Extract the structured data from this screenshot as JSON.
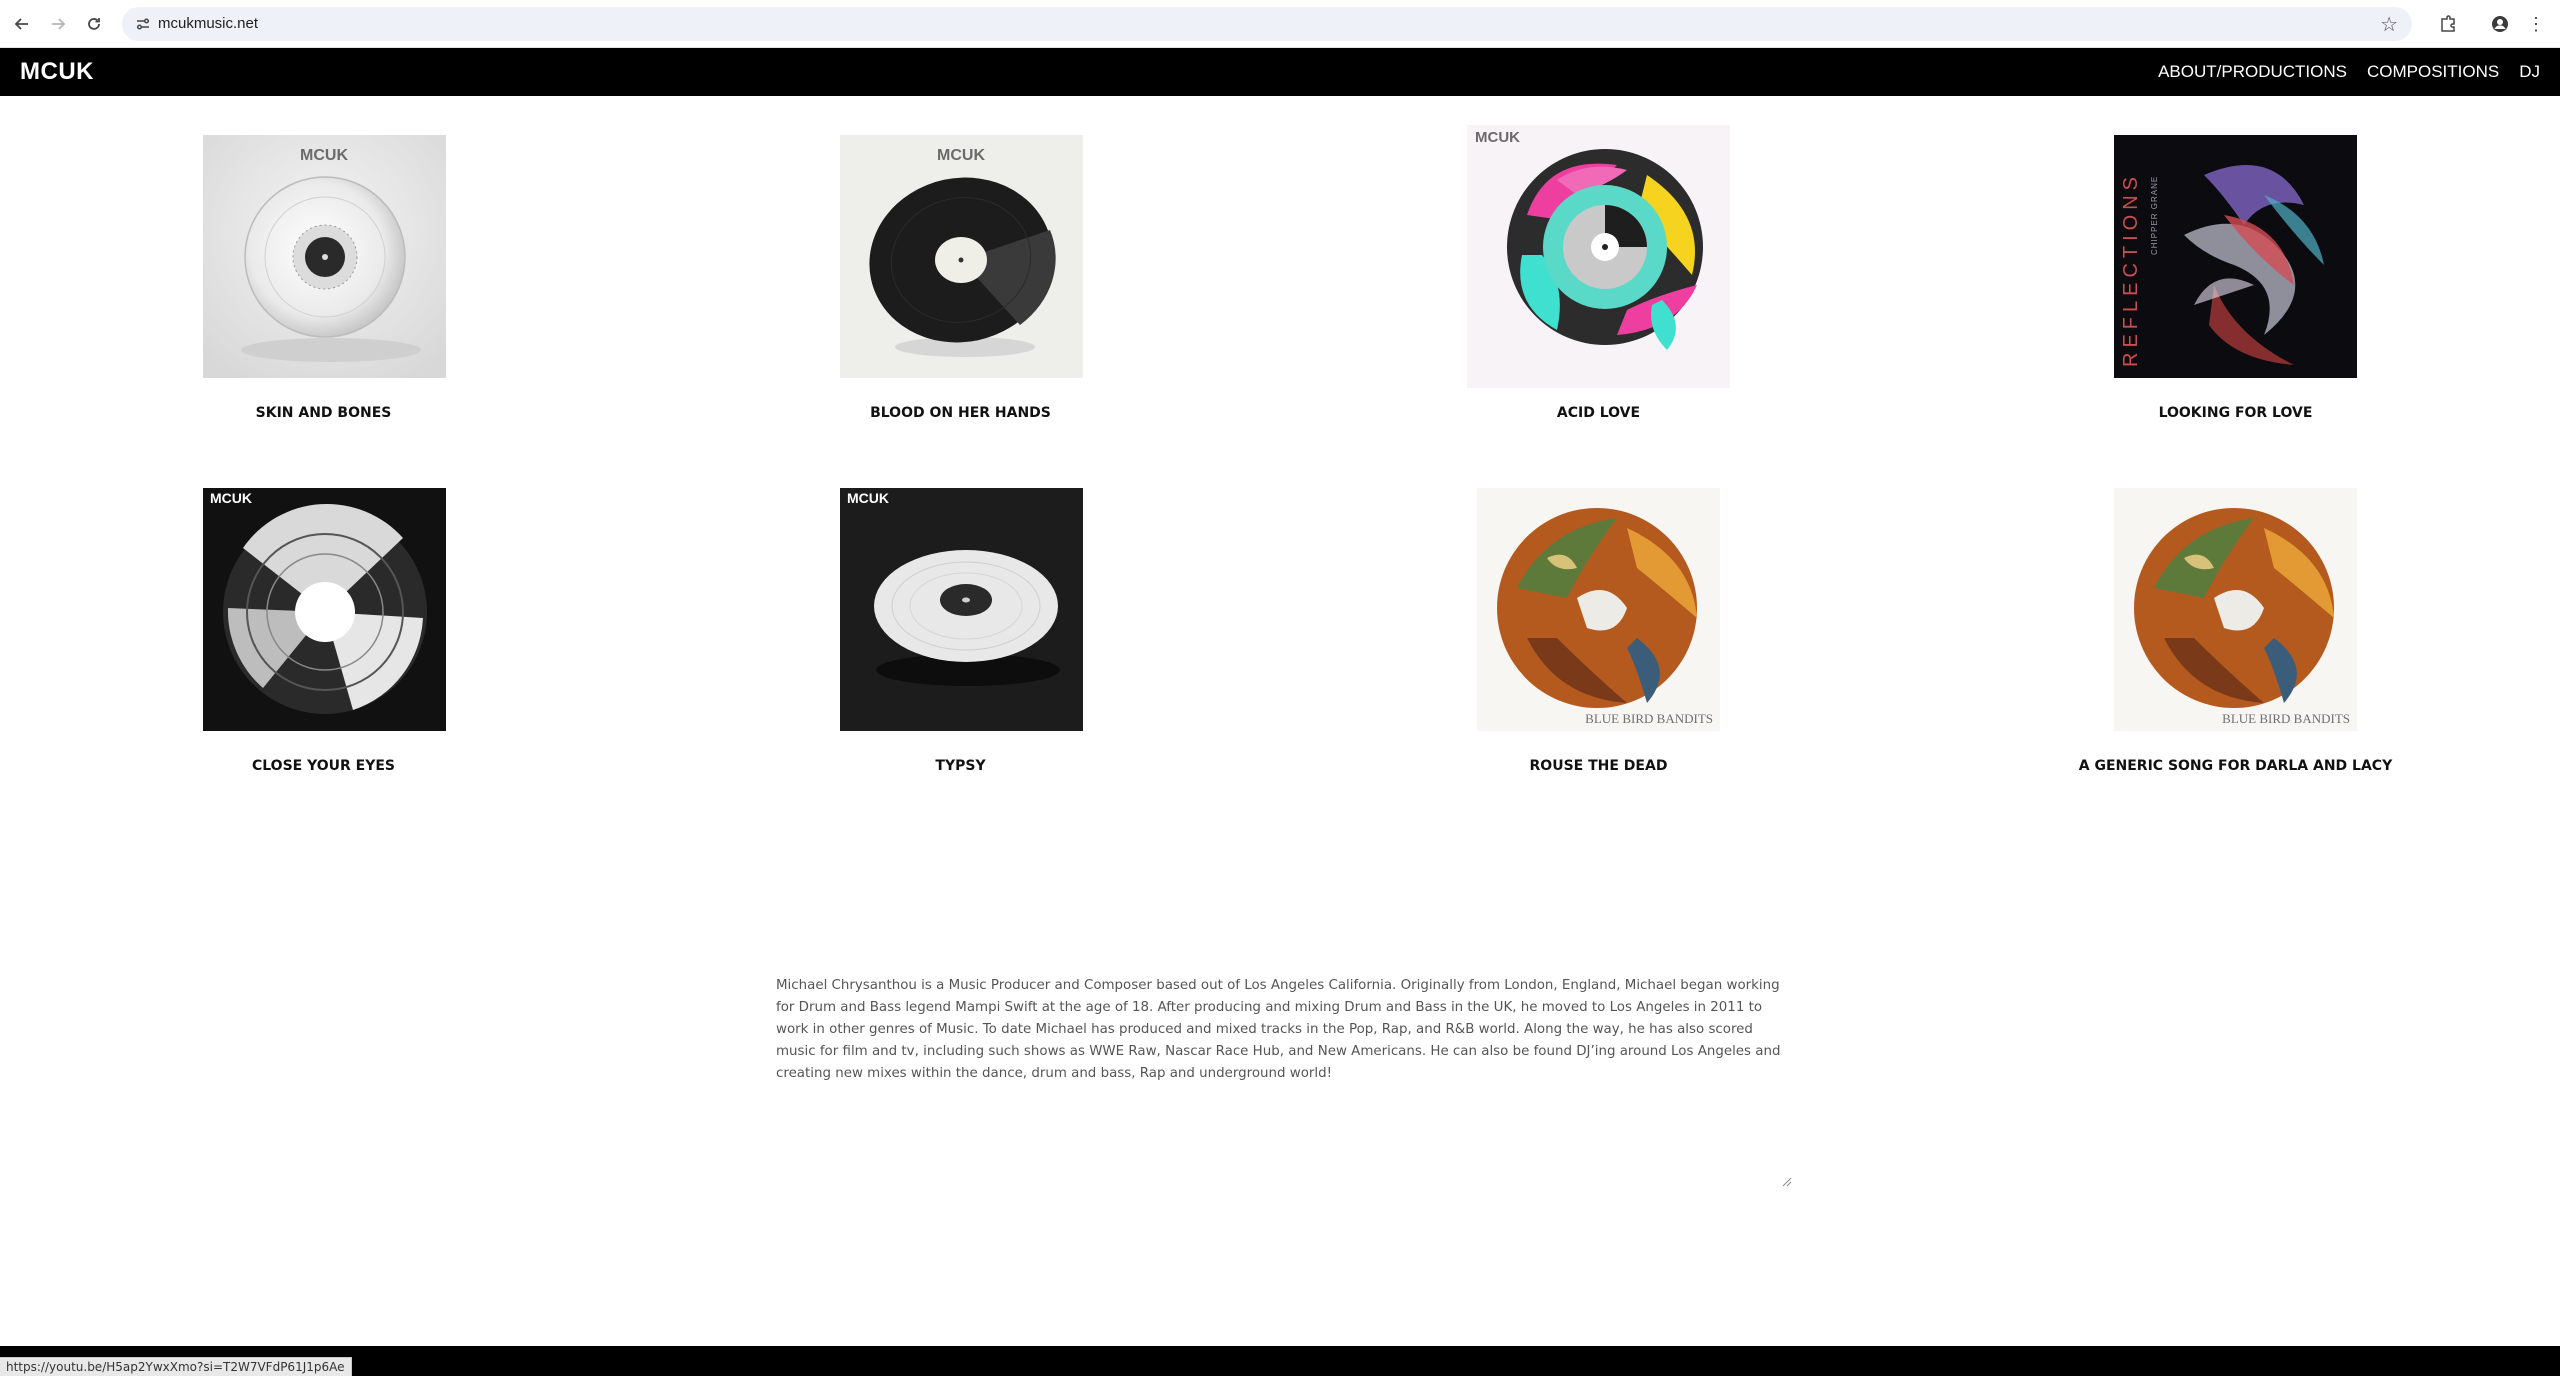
{
  "browser": {
    "url": "mcukmusic.net"
  },
  "site": {
    "logo": "MCUK",
    "nav": [
      "ABOUT/PRODUCTIONS",
      "COMPOSITIONS",
      "DJ"
    ]
  },
  "tracks": [
    {
      "title": "SKIN AND BONES",
      "cover_label": "MCUK"
    },
    {
      "title": "BLOOD ON HER HANDS",
      "cover_label": "MCUK"
    },
    {
      "title": "ACID LOVE",
      "cover_label": "MCUK"
    },
    {
      "title": "LOOKING FOR LOVE",
      "cover_label": "REFLECTIONS",
      "cover_sub": "CHIPPER GRANE"
    },
    {
      "title": "CLOSE YOUR EYES",
      "cover_label": "MCUK"
    },
    {
      "title": "TYPSY",
      "cover_label": "MCUK"
    },
    {
      "title": "ROUSE THE DEAD",
      "cover_label": "BLUE BIRD BANDITS"
    },
    {
      "title": "A GENERIC SONG FOR DARLA AND LACY",
      "cover_label": "BLUE BIRD BANDITS"
    }
  ],
  "bio": "Michael Chrysanthou is a Music Producer and Composer based out of Los Angeles California. Originally from London, England, Michael began working for Drum and Bass legend Mampi Swift at the age of 18.  After producing and mixing Drum and Bass in the UK, he moved to Los Angeles in 2011 to work in other genres of Music. To date Michael has produced and mixed tracks in the Pop, Rap, and R&B world.  Along the way, he has also scored music for film and tv, including such shows as WWE Raw, Nascar Race Hub, and New Americans. He can also be found DJ’ing around Los Angeles and creating new mixes within the dance, drum and bass, Rap and underground world!",
  "status_url": "https://youtu.be/H5ap2YwxXmo?si=T2W7VFdP61J1p6Ae"
}
